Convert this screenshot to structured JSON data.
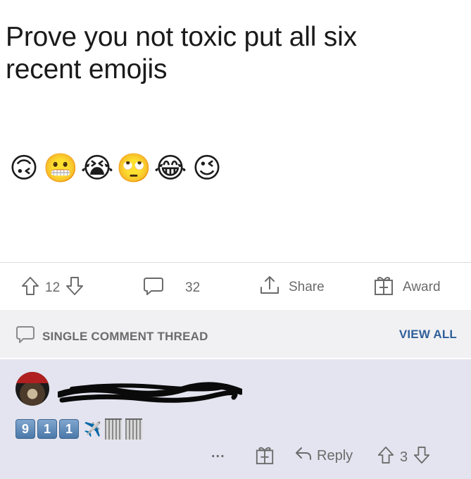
{
  "post": {
    "title_line1": "Prove you not toxic put all six",
    "title_line2": "recent emojis",
    "emojis": [
      "🙃",
      "😬",
      "😭",
      "🙄",
      "😂",
      "😉"
    ]
  },
  "actions": {
    "upvote_count": "12",
    "comment_count": "32",
    "share_label": "Share",
    "award_label": "Award"
  },
  "thread_bar": {
    "label": "SINGLE COMMENT THREAD",
    "view_all_label": "VIEW ALL"
  },
  "comment": {
    "body_keycaps": [
      "9",
      "1",
      "1"
    ],
    "body_emojis": [
      "✈️"
    ],
    "reply_label": "Reply",
    "vote_count": "3",
    "more_label": "..."
  },
  "icons": {
    "upvote": "arrow-up-icon",
    "downvote": "arrow-down-icon",
    "comment": "speech-bubble-icon",
    "share": "share-icon",
    "award": "gift-icon",
    "reply": "reply-arrow-icon"
  },
  "colors": {
    "text_dark": "#1a1a1a",
    "text_muted": "#6b6b6b",
    "thread_bar_bg": "#f1f1f3",
    "comment_bg": "#e3e4ef",
    "link_blue": "#2f5f9a"
  }
}
